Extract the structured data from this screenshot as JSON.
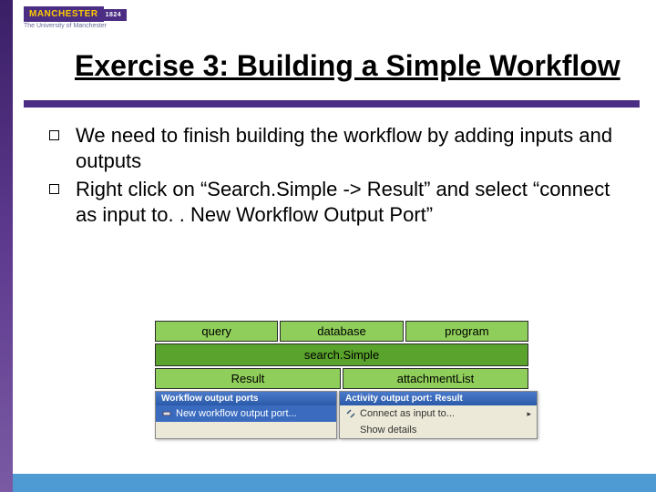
{
  "logo": {
    "name": "MANCHESTER",
    "year": "1824",
    "subtitle": "The University of Manchester"
  },
  "title": "Exercise 3: Building a Simple Workflow",
  "bullets": [
    "We need to finish building the workflow by adding inputs and outputs",
    "Right click on “Search.Simple -> Result” and select “connect as input to. . New Workflow Output Port”"
  ],
  "diagram": {
    "inputs": [
      "query",
      "database",
      "program"
    ],
    "node": "search.Simple",
    "outputs": [
      "Result",
      "attachmentList"
    ]
  },
  "menuLeft": {
    "header": "Workflow output ports",
    "item": "New workflow output port..."
  },
  "menuRight": {
    "header": "Activity output port: Result",
    "connect": "Connect as input to...",
    "details": "Show details"
  }
}
